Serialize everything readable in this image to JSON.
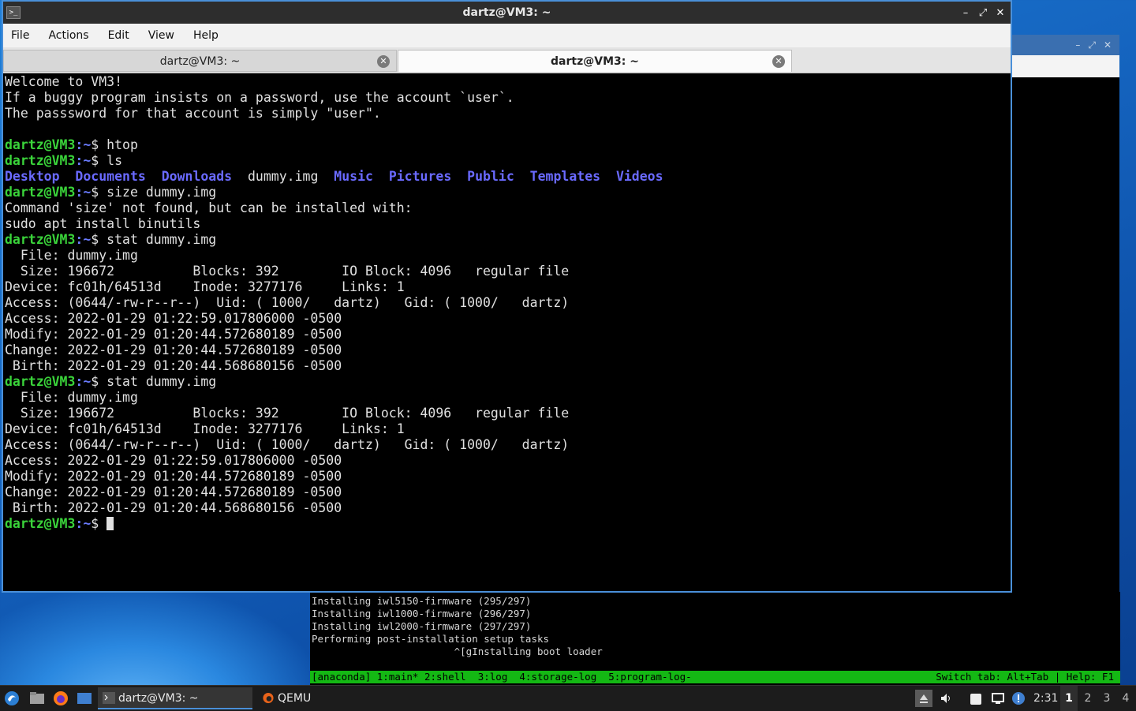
{
  "terminal_window": {
    "title": "dartz@VM3: ~",
    "menu": [
      "File",
      "Actions",
      "Edit",
      "View",
      "Help"
    ],
    "tabs": [
      {
        "label": "dartz@VM3: ~",
        "active": false
      },
      {
        "label": "dartz@VM3: ~",
        "active": true
      }
    ],
    "prompt_user": "dartz@VM3",
    "prompt_path": ":~",
    "prompt_symbol": "$ ",
    "lines": {
      "welcome": "Welcome to VM3!",
      "notice1": "If a buggy program insists on a password, use the account `user`.",
      "notice2": "The passsword for that account is simply \"user\".",
      "cmd_htop": "htop",
      "cmd_ls": "ls",
      "ls_output": [
        "Desktop",
        "Documents",
        "Downloads",
        "dummy.img",
        "Music",
        "Pictures",
        "Public",
        "Templates",
        "Videos"
      ],
      "cmd_size": "size dummy.img",
      "size_err1": "Command 'size' not found, but can be installed with:",
      "size_err2": "sudo apt install binutils",
      "cmd_stat": "stat dummy.img",
      "stat": {
        "file": "  File: dummy.img",
        "size": "  Size: 196672          Blocks: 392        IO Block: 4096   regular file",
        "device": "Device: fc01h/64513d    Inode: 3277176     Links: 1",
        "access_perm": "Access: (0644/-rw-r--r--)  Uid: ( 1000/   dartz)   Gid: ( 1000/   dartz)",
        "access": "Access: 2022-01-29 01:22:59.017806000 -0500",
        "modify": "Modify: 2022-01-29 01:20:44.572680189 -0500",
        "change": "Change: 2022-01-29 01:20:44.572680189 -0500",
        "birth": " Birth: 2022-01-29 01:20:44.568680156 -0500"
      }
    }
  },
  "qemu_console": {
    "log": [
      "Installing iwl5150-firmware (295/297)",
      "Installing iwl1000-firmware (296/297)",
      "Installing iwl2000-firmware (297/297)",
      "Performing post-installation setup tasks",
      "                        ^[gInstalling boot loader"
    ],
    "status_left": "[anaconda] 1:main* 2:shell  3:log  4:storage-log  5:program-log-",
    "status_right": "Switch tab: Alt+Tab | Help: F1"
  },
  "taskbar": {
    "tasks": [
      {
        "label": "dartz@VM3: ~",
        "icon": "terminal-icon",
        "active": true
      },
      {
        "label": "QEMU",
        "icon": "qemu-icon",
        "active": false
      }
    ],
    "clock": "2:31",
    "workspaces": [
      "1",
      "2",
      "3",
      "4"
    ],
    "current_workspace": "1"
  },
  "colors": {
    "prompt_green": "#3ad33a",
    "dir_blue": "#6a6aff",
    "status_green": "#14b814",
    "accent": "#4a90d9"
  }
}
